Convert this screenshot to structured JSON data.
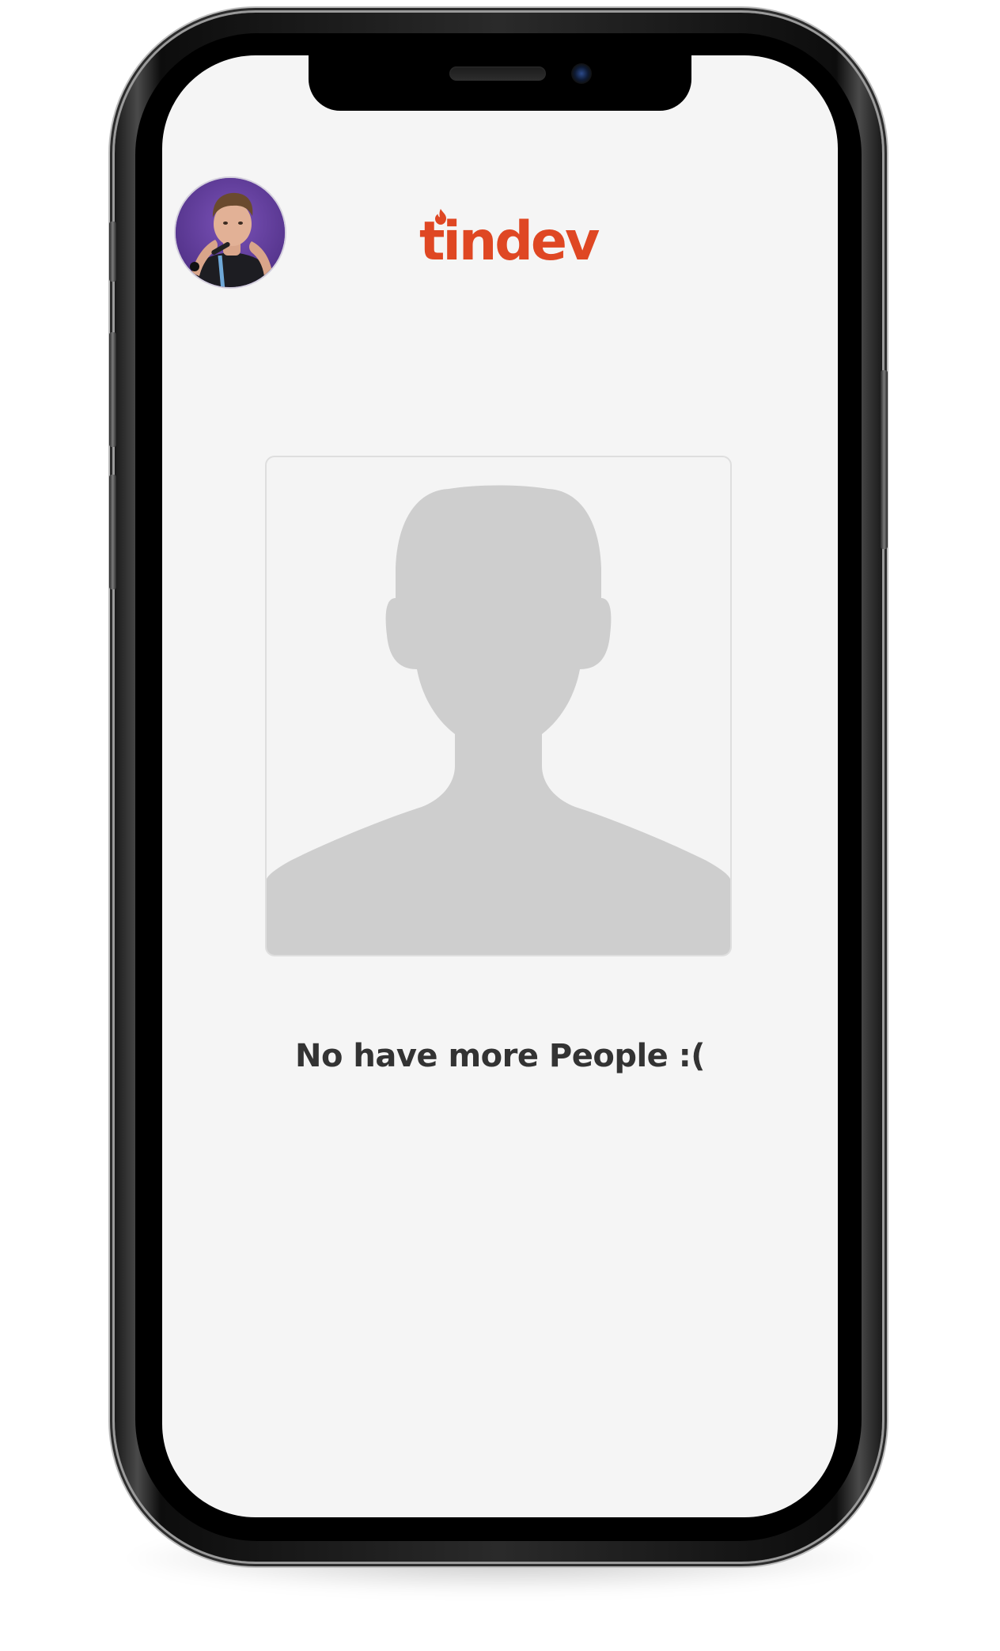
{
  "app": {
    "logo_text": "tindev",
    "brand_color": "#df4723"
  },
  "header": {
    "avatar": "user-avatar",
    "logo_icon": "flame-icon"
  },
  "card": {
    "placeholder_icon": "person-silhouette-icon"
  },
  "empty_state": {
    "message": "No have more People :("
  }
}
